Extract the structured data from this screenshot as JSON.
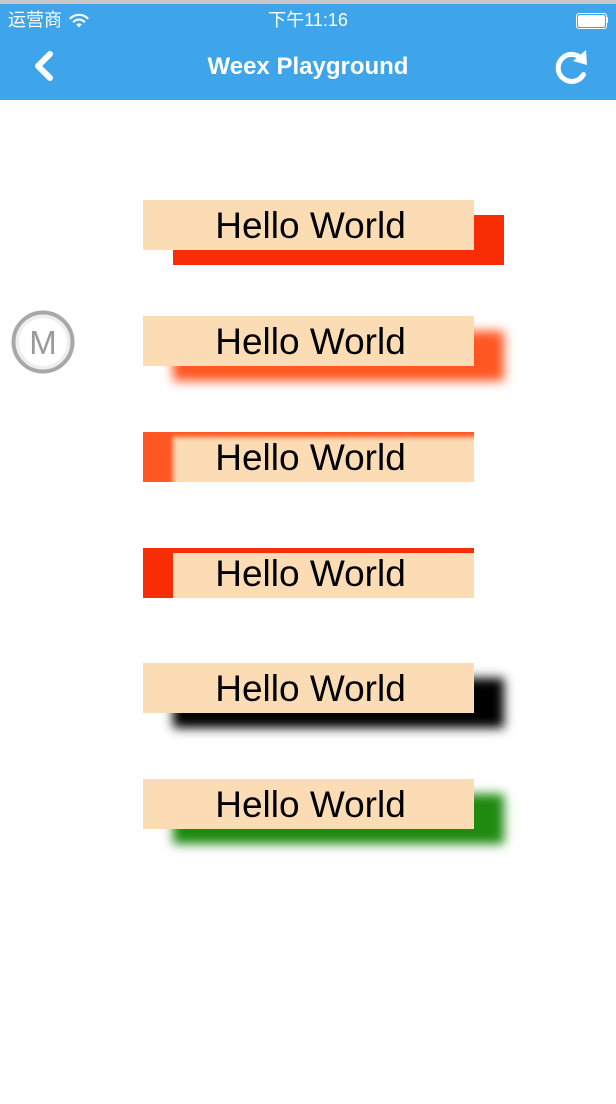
{
  "status_bar": {
    "carrier": "运营商",
    "time": "下午11:16"
  },
  "nav": {
    "title": "Weex Playground",
    "back_icon": "chevron-left-icon",
    "reload_icon": "reload-icon",
    "color": "#3ea5ea"
  },
  "floating_button": {
    "label": "M"
  },
  "items": [
    {
      "text": "Hello World",
      "shadow": "offset solid shadow",
      "shadow_color": "#f92d05"
    },
    {
      "text": "Hello World",
      "shadow": "offset blurred shadow",
      "shadow_color": "#ff5722"
    },
    {
      "text": "Hello World",
      "shadow": "inset blurred shadow",
      "shadow_color": "#ff5722"
    },
    {
      "text": "Hello World",
      "shadow": "inset solid shadow",
      "shadow_color": "#f92d05"
    },
    {
      "text": "Hello World",
      "shadow": "offset blurred shadow",
      "shadow_color": "#000000"
    },
    {
      "text": "Hello World",
      "shadow": "offset blurred shadow",
      "shadow_color": "#1f8a10"
    }
  ],
  "item_background": "#fcdcb4"
}
